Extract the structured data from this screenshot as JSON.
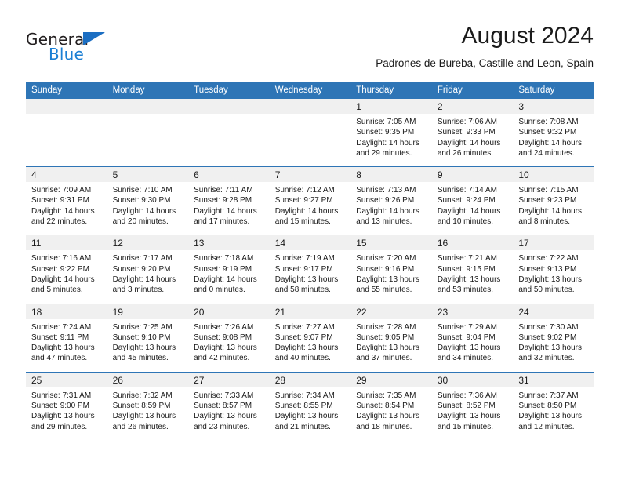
{
  "logo": {
    "word_top": "General",
    "word_bottom": "Blue",
    "accent_color": "#1b6ec2",
    "blue_color": "#1b7fd4",
    "triangle_icon": "triangle-icon"
  },
  "header": {
    "title": "August 2024",
    "subtitle": "Padrones de Bureba, Castille and Leon, Spain"
  },
  "theme": {
    "header_bg": "#2e75b6",
    "header_text": "#ffffff",
    "daynum_bg": "#f0f0f0",
    "row_divider": "#2e75b6"
  },
  "calendar": {
    "weekday_headers": [
      "Sunday",
      "Monday",
      "Tuesday",
      "Wednesday",
      "Thursday",
      "Friday",
      "Saturday"
    ],
    "weeks": [
      [
        {
          "day": "",
          "lines": []
        },
        {
          "day": "",
          "lines": []
        },
        {
          "day": "",
          "lines": []
        },
        {
          "day": "",
          "lines": []
        },
        {
          "day": "1",
          "lines": [
            "Sunrise: 7:05 AM",
            "Sunset: 9:35 PM",
            "Daylight: 14 hours",
            "and 29 minutes."
          ]
        },
        {
          "day": "2",
          "lines": [
            "Sunrise: 7:06 AM",
            "Sunset: 9:33 PM",
            "Daylight: 14 hours",
            "and 26 minutes."
          ]
        },
        {
          "day": "3",
          "lines": [
            "Sunrise: 7:08 AM",
            "Sunset: 9:32 PM",
            "Daylight: 14 hours",
            "and 24 minutes."
          ]
        }
      ],
      [
        {
          "day": "4",
          "lines": [
            "Sunrise: 7:09 AM",
            "Sunset: 9:31 PM",
            "Daylight: 14 hours",
            "and 22 minutes."
          ]
        },
        {
          "day": "5",
          "lines": [
            "Sunrise: 7:10 AM",
            "Sunset: 9:30 PM",
            "Daylight: 14 hours",
            "and 20 minutes."
          ]
        },
        {
          "day": "6",
          "lines": [
            "Sunrise: 7:11 AM",
            "Sunset: 9:28 PM",
            "Daylight: 14 hours",
            "and 17 minutes."
          ]
        },
        {
          "day": "7",
          "lines": [
            "Sunrise: 7:12 AM",
            "Sunset: 9:27 PM",
            "Daylight: 14 hours",
            "and 15 minutes."
          ]
        },
        {
          "day": "8",
          "lines": [
            "Sunrise: 7:13 AM",
            "Sunset: 9:26 PM",
            "Daylight: 14 hours",
            "and 13 minutes."
          ]
        },
        {
          "day": "9",
          "lines": [
            "Sunrise: 7:14 AM",
            "Sunset: 9:24 PM",
            "Daylight: 14 hours",
            "and 10 minutes."
          ]
        },
        {
          "day": "10",
          "lines": [
            "Sunrise: 7:15 AM",
            "Sunset: 9:23 PM",
            "Daylight: 14 hours",
            "and 8 minutes."
          ]
        }
      ],
      [
        {
          "day": "11",
          "lines": [
            "Sunrise: 7:16 AM",
            "Sunset: 9:22 PM",
            "Daylight: 14 hours",
            "and 5 minutes."
          ]
        },
        {
          "day": "12",
          "lines": [
            "Sunrise: 7:17 AM",
            "Sunset: 9:20 PM",
            "Daylight: 14 hours",
            "and 3 minutes."
          ]
        },
        {
          "day": "13",
          "lines": [
            "Sunrise: 7:18 AM",
            "Sunset: 9:19 PM",
            "Daylight: 14 hours",
            "and 0 minutes."
          ]
        },
        {
          "day": "14",
          "lines": [
            "Sunrise: 7:19 AM",
            "Sunset: 9:17 PM",
            "Daylight: 13 hours",
            "and 58 minutes."
          ]
        },
        {
          "day": "15",
          "lines": [
            "Sunrise: 7:20 AM",
            "Sunset: 9:16 PM",
            "Daylight: 13 hours",
            "and 55 minutes."
          ]
        },
        {
          "day": "16",
          "lines": [
            "Sunrise: 7:21 AM",
            "Sunset: 9:15 PM",
            "Daylight: 13 hours",
            "and 53 minutes."
          ]
        },
        {
          "day": "17",
          "lines": [
            "Sunrise: 7:22 AM",
            "Sunset: 9:13 PM",
            "Daylight: 13 hours",
            "and 50 minutes."
          ]
        }
      ],
      [
        {
          "day": "18",
          "lines": [
            "Sunrise: 7:24 AM",
            "Sunset: 9:11 PM",
            "Daylight: 13 hours",
            "and 47 minutes."
          ]
        },
        {
          "day": "19",
          "lines": [
            "Sunrise: 7:25 AM",
            "Sunset: 9:10 PM",
            "Daylight: 13 hours",
            "and 45 minutes."
          ]
        },
        {
          "day": "20",
          "lines": [
            "Sunrise: 7:26 AM",
            "Sunset: 9:08 PM",
            "Daylight: 13 hours",
            "and 42 minutes."
          ]
        },
        {
          "day": "21",
          "lines": [
            "Sunrise: 7:27 AM",
            "Sunset: 9:07 PM",
            "Daylight: 13 hours",
            "and 40 minutes."
          ]
        },
        {
          "day": "22",
          "lines": [
            "Sunrise: 7:28 AM",
            "Sunset: 9:05 PM",
            "Daylight: 13 hours",
            "and 37 minutes."
          ]
        },
        {
          "day": "23",
          "lines": [
            "Sunrise: 7:29 AM",
            "Sunset: 9:04 PM",
            "Daylight: 13 hours",
            "and 34 minutes."
          ]
        },
        {
          "day": "24",
          "lines": [
            "Sunrise: 7:30 AM",
            "Sunset: 9:02 PM",
            "Daylight: 13 hours",
            "and 32 minutes."
          ]
        }
      ],
      [
        {
          "day": "25",
          "lines": [
            "Sunrise: 7:31 AM",
            "Sunset: 9:00 PM",
            "Daylight: 13 hours",
            "and 29 minutes."
          ]
        },
        {
          "day": "26",
          "lines": [
            "Sunrise: 7:32 AM",
            "Sunset: 8:59 PM",
            "Daylight: 13 hours",
            "and 26 minutes."
          ]
        },
        {
          "day": "27",
          "lines": [
            "Sunrise: 7:33 AM",
            "Sunset: 8:57 PM",
            "Daylight: 13 hours",
            "and 23 minutes."
          ]
        },
        {
          "day": "28",
          "lines": [
            "Sunrise: 7:34 AM",
            "Sunset: 8:55 PM",
            "Daylight: 13 hours",
            "and 21 minutes."
          ]
        },
        {
          "day": "29",
          "lines": [
            "Sunrise: 7:35 AM",
            "Sunset: 8:54 PM",
            "Daylight: 13 hours",
            "and 18 minutes."
          ]
        },
        {
          "day": "30",
          "lines": [
            "Sunrise: 7:36 AM",
            "Sunset: 8:52 PM",
            "Daylight: 13 hours",
            "and 15 minutes."
          ]
        },
        {
          "day": "31",
          "lines": [
            "Sunrise: 7:37 AM",
            "Sunset: 8:50 PM",
            "Daylight: 13 hours",
            "and 12 minutes."
          ]
        }
      ]
    ]
  }
}
